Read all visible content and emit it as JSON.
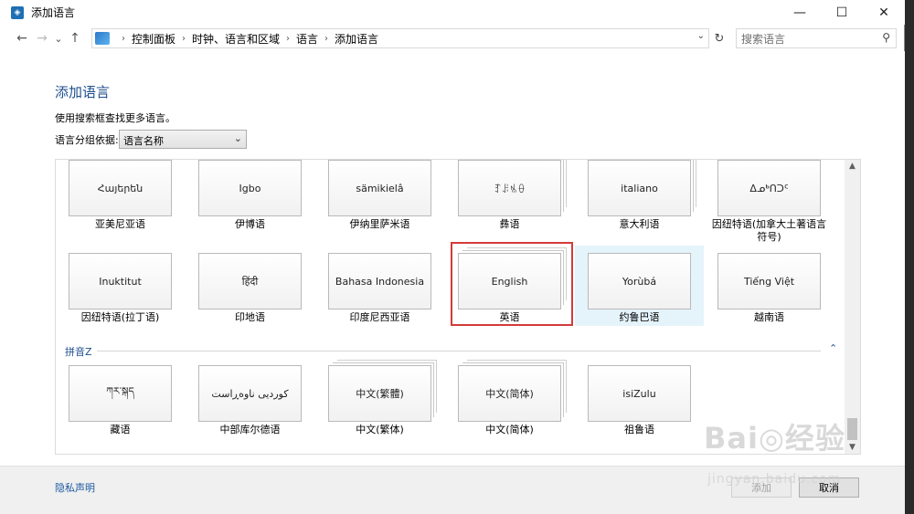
{
  "window": {
    "title": "添加语言",
    "minimize": "—",
    "maximize": "☐",
    "close": "✕"
  },
  "nav": {
    "back": "←",
    "forward": "→",
    "recent": "⌄",
    "up": "↑",
    "breadcrumb": [
      "控制面板",
      "时钟、语言和区域",
      "语言",
      "添加语言"
    ],
    "breadcrumb_sep": "›",
    "refresh": "↻",
    "search_placeholder": "搜索语言"
  },
  "page": {
    "heading": "添加语言",
    "description": "使用搜索框查找更多语言。",
    "group_by_label": "语言分组依据:",
    "group_by_value": "语言名称"
  },
  "rows": [
    {
      "tiles": [
        {
          "native": "Հայերեն",
          "name": "亚美尼亚语",
          "stack": false
        },
        {
          "native": "Igbo",
          "name": "伊博语",
          "stack": false
        },
        {
          "native": "sämikielâ",
          "name": "伊纳里萨米语",
          "stack": false
        },
        {
          "native": "ꆈꌠꁱꂷ",
          "name": "彝语",
          "stack": true
        },
        {
          "native": "italiano",
          "name": "意大利语",
          "stack": true
        },
        {
          "native": "ᐃᓄᒃᑎᑐᑦ",
          "name": "因纽特语(加拿大土著语言符号)",
          "stack": false
        }
      ]
    },
    {
      "tiles": [
        {
          "native": "Inuktitut",
          "name": "因纽特语(拉丁语)",
          "stack": false
        },
        {
          "native": "हिंदी",
          "name": "印地语",
          "stack": false
        },
        {
          "native": "Bahasa Indonesia",
          "name": "印度尼西亚语",
          "stack": false
        },
        {
          "native": "English",
          "name": "英语",
          "stack": true
        },
        {
          "native": "Yorùbá",
          "name": "约鲁巴语",
          "stack": false
        },
        {
          "native": "Tiếng Việt",
          "name": "越南语",
          "stack": false
        }
      ]
    }
  ],
  "section_z": {
    "label": "拼音Z",
    "collapse": "⌃",
    "tiles": [
      {
        "native": "ཀར་སྐད",
        "name": "藏语",
        "stack": false
      },
      {
        "native": "کوردیی ناوەڕاست",
        "name": "中部库尔德语",
        "stack": false
      },
      {
        "native": "中文(繁體)",
        "name": "中文(繁体)",
        "stack": true
      },
      {
        "native": "中文(简体)",
        "name": "中文(简体)",
        "stack": true
      },
      {
        "native": "isiZulu",
        "name": "祖鲁语",
        "stack": false
      }
    ]
  },
  "footer": {
    "privacy": "隐私声明",
    "add": "添加",
    "cancel": "取消"
  },
  "watermark": {
    "line1": "Bai◎经验",
    "line2": "jingyan.baidu.com"
  },
  "colors": {
    "accent": "#1e4f8e",
    "selection_highlight": "#e5f3fb",
    "annotation_red": "#d43b3b"
  }
}
